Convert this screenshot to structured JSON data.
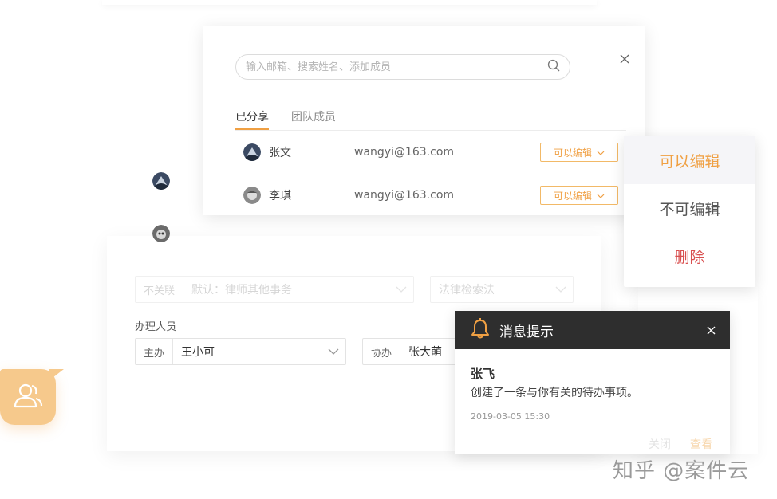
{
  "share_dialog": {
    "search_placeholder": "输入邮箱、搜索姓名、添加成员",
    "tabs": [
      "已分享",
      "团队成员"
    ],
    "members": [
      {
        "name": "张文",
        "email": "wangyi@163.com",
        "permission": "可以编辑"
      },
      {
        "name": "李琪",
        "email": "wangyi@163.com",
        "permission": "可以编辑"
      }
    ]
  },
  "permission_dropdown": {
    "options": [
      "可以编辑",
      "不可编辑",
      "删除"
    ],
    "selected": "可以编辑",
    "colors": {
      "accent": "#f0a043",
      "danger": "#d95050"
    }
  },
  "form": {
    "faded_select_1": {
      "prefix": "不关联",
      "value": "默认：律师其他事务"
    },
    "faded_select_2": {
      "value": "法律检索法"
    },
    "section_label": "办理人员",
    "lead": {
      "prefix": "主办",
      "value": "王小可"
    },
    "assist": {
      "prefix": "协办",
      "value": "张大萌"
    }
  },
  "notification": {
    "title": "消息提示",
    "sender": "张飞",
    "message": "创建了一条与你有关的待办事项。",
    "time": "2019-03-05  15:30",
    "close_label": "关闭",
    "view_label": "查看"
  },
  "watermark": "知乎 @案件云",
  "icons": {
    "search": "search-icon",
    "close": "close-icon",
    "bell": "bell-icon",
    "chevron": "chevron-down-icon",
    "users": "users-icon"
  }
}
